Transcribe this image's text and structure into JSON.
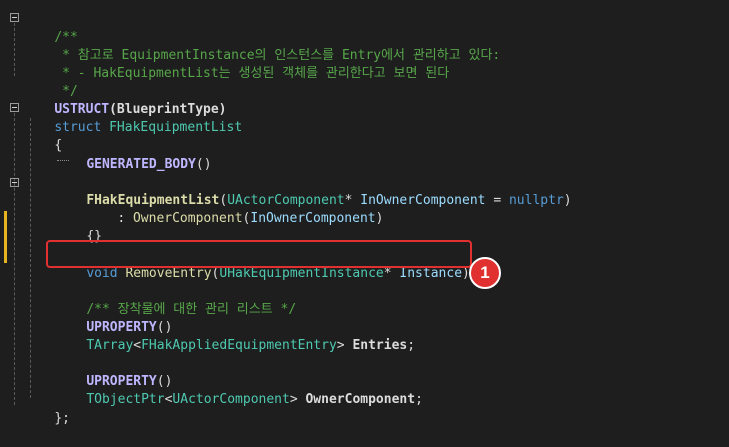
{
  "code": {
    "comment_open": "/**",
    "comment_line1": " * 참고로 EquipmentInstance의 인스턴스를 Entry에서 관리하고 있다:",
    "comment_line2": " * - HakEquipmentList는 생성된 객체를 관리한다고 보면 된다",
    "comment_close": " */",
    "ustruct_macro": "USTRUCT",
    "ustruct_arg": "(BlueprintType)",
    "struct_kw": "struct",
    "struct_name": " FHakEquipmentList",
    "open_brace": "{",
    "generated_body": "GENERATED_BODY",
    "generated_body_parens": "()",
    "ctor_name": "FHakEquipmentList",
    "ctor_open": "(",
    "ctor_param_type": "UActorComponent",
    "ctor_param_rest": "* ",
    "ctor_param_name": "InOwnerComponent",
    "ctor_assign": " = ",
    "ctor_nullptr": "nullptr",
    "ctor_close": ")",
    "init_prefix": ": ",
    "init_member": "OwnerComponent",
    "init_open": "(",
    "init_arg": "InOwnerComponent",
    "init_close": ")",
    "ctor_body": "{}",
    "void_kw": "void",
    "method_name": " RemoveEntry",
    "method_open": "(",
    "method_param_type": "UHakEquipmentInstance",
    "method_param_rest": "* ",
    "method_param_name": "Instance",
    "method_close": ");",
    "doc_comment": "/** 장착물에 대한 관리 리스트 */",
    "uproperty1": "UPROPERTY",
    "uproperty1_parens": "()",
    "tarray": "TArray",
    "tarray_lt": "<",
    "tarray_inner": "FHakAppliedEquipmentEntry",
    "tarray_gt": "> ",
    "entries": "Entries",
    "entries_semi": ";",
    "uproperty2": "UPROPERTY",
    "uproperty2_parens": "()",
    "tobjectptr": "TObjectPtr",
    "tobj_lt": "<",
    "tobj_inner": "UActorComponent",
    "tobj_gt": "> ",
    "owner_member": "OwnerComponent",
    "owner_semi": ";",
    "close_brace": "};"
  },
  "annotation": {
    "badge_number": "1",
    "highlight_color": "#e03030"
  },
  "colors": {
    "background": "#1e1e1e",
    "comment": "#57a64a",
    "keyword": "#569cd6",
    "type": "#4ec9b0",
    "macro": "#beb7ff",
    "function": "#dcdcaa",
    "parameter": "#9cdcfe",
    "change_marker": "#e6b420"
  }
}
